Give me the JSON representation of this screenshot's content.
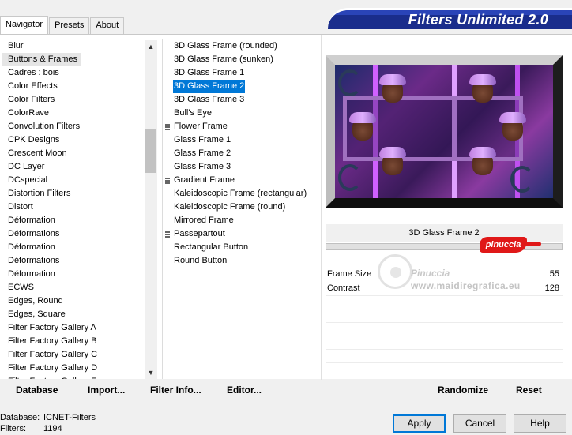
{
  "app": {
    "banner_title": "Filters Unlimited 2.0"
  },
  "tabs": [
    {
      "label": "Navigator",
      "active": true
    },
    {
      "label": "Presets",
      "active": false
    },
    {
      "label": "About",
      "active": false
    }
  ],
  "categories": {
    "selected": "Buttons & Frames",
    "items": [
      "Blur",
      "Buttons & Frames",
      "Cadres : bois",
      "Color Effects",
      "Color Filters",
      "ColorRave",
      "Convolution Filters",
      "CPK Designs",
      "Crescent Moon",
      "DC Layer",
      "DCspecial",
      "Distortion Filters",
      "Distort",
      "Déformation",
      "Déformations",
      "Déformation",
      "Déformations",
      "Déformation",
      "ECWS",
      "Edges, Round",
      "Edges, Square",
      "Filter Factory Gallery A",
      "Filter Factory Gallery B",
      "Filter Factory Gallery C",
      "Filter Factory Gallery D",
      "Filter Factory Gallery E"
    ]
  },
  "filters": {
    "selected": "3D Glass Frame 2",
    "items": [
      {
        "label": "3D Glass Frame (rounded)",
        "marker": false
      },
      {
        "label": "3D Glass Frame (sunken)",
        "marker": false
      },
      {
        "label": "3D Glass Frame 1",
        "marker": false
      },
      {
        "label": "3D Glass Frame 2",
        "marker": false
      },
      {
        "label": "3D Glass Frame 3",
        "marker": false
      },
      {
        "label": "Bull's Eye",
        "marker": false
      },
      {
        "label": "Flower Frame",
        "marker": true
      },
      {
        "label": "Glass Frame 1",
        "marker": false
      },
      {
        "label": "Glass Frame 2",
        "marker": false
      },
      {
        "label": "Glass Frame 3",
        "marker": false
      },
      {
        "label": "Gradient Frame",
        "marker": true
      },
      {
        "label": "Kaleidoscopic Frame (rectangular)",
        "marker": false
      },
      {
        "label": "Kaleidoscopic Frame (round)",
        "marker": false
      },
      {
        "label": "Mirrored Frame",
        "marker": false
      },
      {
        "label": "Passepartout",
        "marker": true
      },
      {
        "label": "Rectangular Button",
        "marker": false
      },
      {
        "label": "Round Button",
        "marker": false
      }
    ]
  },
  "preview": {
    "filter_name": "3D Glass Frame 2"
  },
  "params": [
    {
      "label": "Frame Size",
      "value": "55"
    },
    {
      "label": "Contrast",
      "value": "128"
    }
  ],
  "watermark": {
    "badge": "pinuccia",
    "name": "Pinuccia",
    "url": "www.maidiregrafica.eu"
  },
  "toolbar": {
    "database": "Database",
    "import": "Import...",
    "filter_info": "Filter Info...",
    "editor": "Editor...",
    "randomize": "Randomize",
    "reset": "Reset"
  },
  "status": {
    "database_label": "Database:",
    "database_value": "ICNET-Filters",
    "filters_label": "Filters:",
    "filters_value": "1194"
  },
  "dialog_buttons": {
    "apply": "Apply",
    "cancel": "Cancel",
    "help": "Help"
  }
}
